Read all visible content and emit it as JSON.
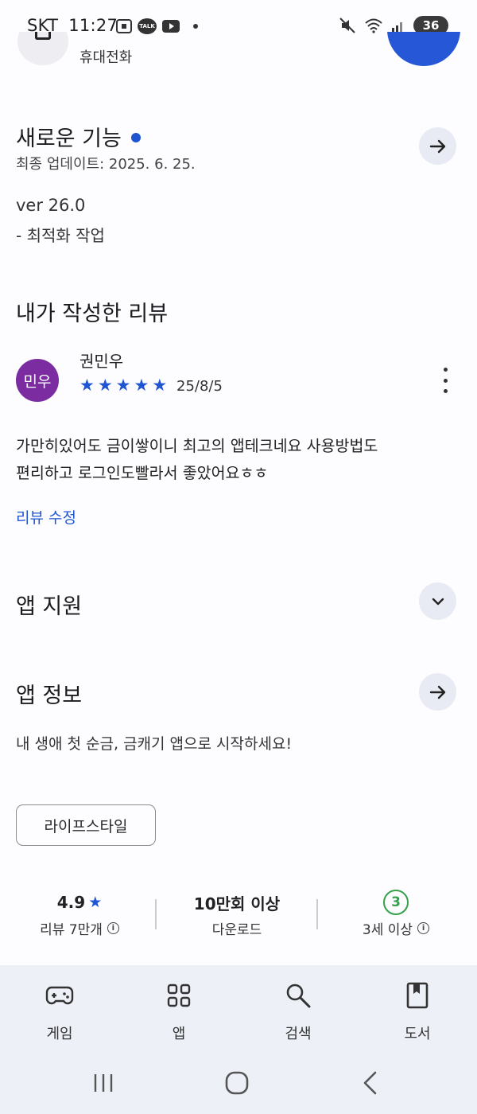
{
  "status_bar": {
    "carrier": "SKT",
    "time": "11:27",
    "talk_label": "TALK",
    "battery": "36"
  },
  "top": {
    "subtitle": "휴대전화"
  },
  "whats_new": {
    "title": "새로운 기능",
    "updated": "최종 업데이트: 2025. 6. 25.",
    "version": "ver 26.0",
    "note": "- 최적화 작업"
  },
  "my_review": {
    "title": "내가 작성한 리뷰",
    "avatar_text": "민우",
    "reviewer": "권민우",
    "rating": 5,
    "date": "25/8/5",
    "body_line1": "가만히있어도 금이쌓이니 최고의 앱테크네요 사용방법도",
    "body_line2": "편리하고 로그인도빨라서 좋았어요ㅎㅎ",
    "edit_link": "리뷰 수정"
  },
  "app_support": {
    "title": "앱 지원"
  },
  "app_info": {
    "title": "앱 정보",
    "description": "내 생애 첫 순금, 금캐기 앱으로 시작하세요!",
    "category_chip": "라이프스타일"
  },
  "stats": {
    "rating_value": "4.9",
    "rating_label": "리뷰 7만개",
    "downloads_value": "10만회 이상",
    "downloads_label": "다운로드",
    "age_value": "3",
    "age_label": "3세 이상"
  },
  "bottom_nav": {
    "items": [
      {
        "label": "게임",
        "icon": "gamepad-icon"
      },
      {
        "label": "앱",
        "icon": "apps-grid-icon"
      },
      {
        "label": "검색",
        "icon": "search-icon"
      },
      {
        "label": "도서",
        "icon": "book-icon"
      }
    ]
  },
  "colors": {
    "accent": "#1f55d0",
    "avatar": "#7b2ca0",
    "age_green": "#36a04a",
    "nav_bg": "#edf0f7"
  }
}
